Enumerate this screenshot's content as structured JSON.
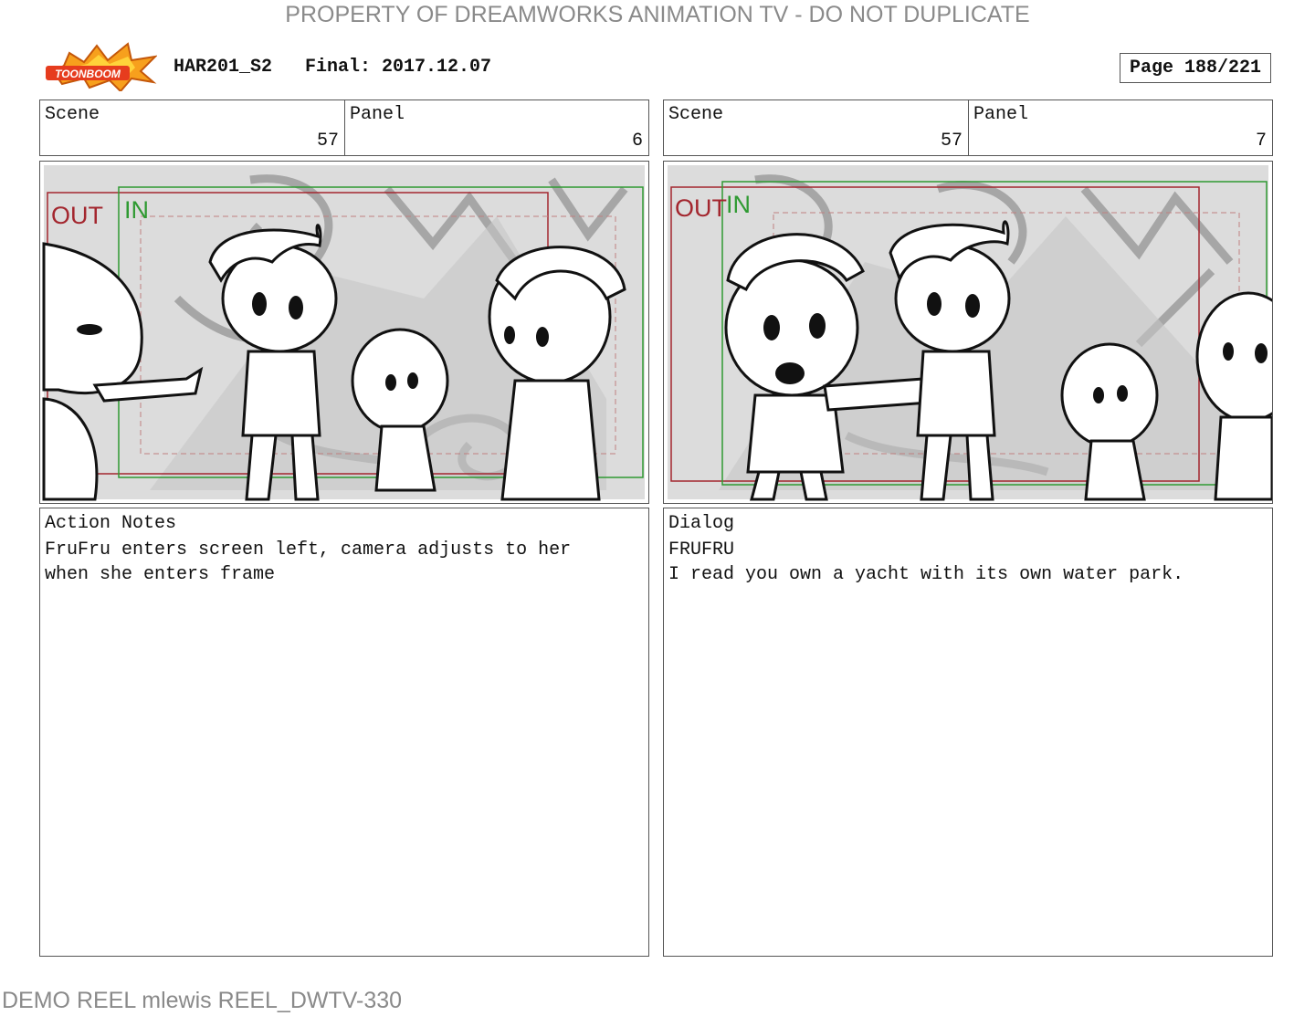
{
  "watermark_top": "PROPERTY OF DREAMWORKS ANIMATION TV - DO NOT DUPLICATE",
  "watermark_bottom": "DEMO REEL mlewis REEL_DWTV-330",
  "logo": {
    "text": "TOONBOOM",
    "icon": "toonboom-logo-icon"
  },
  "header": {
    "project": "HAR201_S2",
    "final_label": "Final: 2017.12.07",
    "page": "Page 188/221"
  },
  "panels": [
    {
      "scene_label": "Scene",
      "scene_value": "57",
      "panel_label": "Panel",
      "panel_value": "6",
      "frame_out": "OUT",
      "frame_in": "IN",
      "notes_label": "Action Notes",
      "notes_text": "FruFru enters screen left, camera adjusts to her\nwhen she enters frame"
    },
    {
      "scene_label": "Scene",
      "scene_value": "57",
      "panel_label": "Panel",
      "panel_value": "7",
      "frame_out": "OUT",
      "frame_in": "IN",
      "notes_label": "Dialog",
      "notes_text": "FRUFRU\nI read you own a yacht with its own water park."
    }
  ],
  "colors": {
    "out_frame": "#a3262e",
    "in_frame": "#2f9a32",
    "sketch_bg": "#dcdcdc"
  }
}
